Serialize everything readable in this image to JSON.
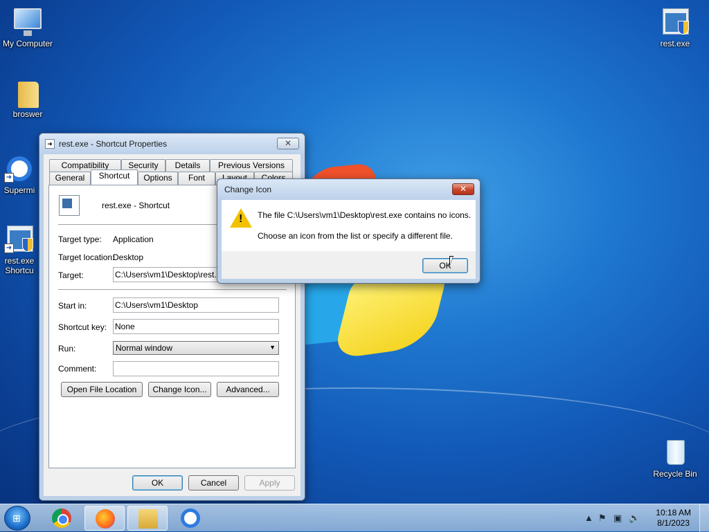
{
  "desktop": {
    "icons": [
      {
        "label": "My Computer",
        "icon": "monitor-icon"
      },
      {
        "label": "broswer",
        "icon": "folder-icon"
      },
      {
        "label": "Supermi",
        "icon": "chrome-like-icon"
      },
      {
        "label": "rest.exe",
        "label2": "Shortcu",
        "icon": "exe-shortcut-icon"
      },
      {
        "label": "rest.exe",
        "icon": "exe-icon"
      },
      {
        "label": "Recycle Bin",
        "icon": "recycle-bin-icon"
      }
    ]
  },
  "properties": {
    "title": "rest.exe - Shortcut Properties",
    "tabs_row1": [
      "Compatibility",
      "Security",
      "Details",
      "Previous Versions"
    ],
    "tabs_row2": [
      "General",
      "Shortcut",
      "Options",
      "Font",
      "Layout",
      "Colors"
    ],
    "active_tab": "Shortcut",
    "header_name": "rest.exe - Shortcut",
    "target_type_label": "Target type:",
    "target_type_value": "Application",
    "target_location_label": "Target location:",
    "target_location_value": "Desktop",
    "target_label": "Target:",
    "target_value": "C:\\Users\\vm1\\Desktop\\rest.exe",
    "start_in_label": "Start in:",
    "start_in_value": "C:\\Users\\vm1\\Desktop",
    "shortcut_key_label": "Shortcut key:",
    "shortcut_key_value": "None",
    "run_label": "Run:",
    "run_value": "Normal window",
    "comment_label": "Comment:",
    "comment_value": "",
    "open_file_location": "Open File Location",
    "change_icon": "Change Icon...",
    "advanced": "Advanced...",
    "ok": "OK",
    "cancel": "Cancel",
    "apply": "Apply"
  },
  "change_icon_dialog": {
    "title": "Change Icon",
    "message1": "The file C:\\Users\\vm1\\Desktop\\rest.exe contains no icons.",
    "message2": "Choose an icon from the list or specify a different file.",
    "ok": "OK"
  },
  "taskbar": {
    "time": "10:18 AM",
    "date": "8/1/2023",
    "apps": [
      "chrome-icon",
      "firefox-icon",
      "explorer-icon",
      "app-icon"
    ]
  }
}
